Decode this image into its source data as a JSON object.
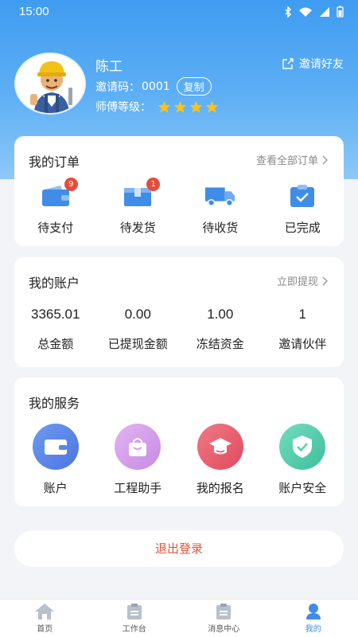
{
  "status_bar": {
    "time": "15:00"
  },
  "profile": {
    "name": "陈工",
    "invite_label": "邀请码：",
    "invite_code": "0001",
    "copy_label": "复制",
    "level_label": "师傅等级：",
    "stars": 4,
    "invite_friend_label": "邀请好友"
  },
  "orders": {
    "title": "我的订单",
    "link": "查看全部订单",
    "items": [
      {
        "label": "待支付",
        "badge": "9",
        "icon": "wallet-icon"
      },
      {
        "label": "待发货",
        "badge": "1",
        "icon": "package-icon"
      },
      {
        "label": "待收货",
        "badge": "",
        "icon": "truck-icon"
      },
      {
        "label": "已完成",
        "badge": "",
        "icon": "clipboard-check-icon"
      }
    ]
  },
  "account": {
    "title": "我的账户",
    "link": "立即提现",
    "items": [
      {
        "value": "3365.01",
        "label": "总金额"
      },
      {
        "value": "0.00",
        "label": "已提现金额"
      },
      {
        "value": "1.00",
        "label": "冻结资金"
      },
      {
        "value": "1",
        "label": "邀请伙伴"
      }
    ]
  },
  "services": {
    "title": "我的服务",
    "items": [
      {
        "label": "账户",
        "icon": "wallet-icon",
        "color": "#5b86e8"
      },
      {
        "label": "工程助手",
        "icon": "bag-icon",
        "color": "#d6a0ec"
      },
      {
        "label": "我的报名",
        "icon": "graduation-cap-icon",
        "color": "#e85a6e"
      },
      {
        "label": "账户安全",
        "icon": "shield-check-icon",
        "color": "#58cfb0"
      }
    ]
  },
  "logout_label": "退出登录",
  "tabbar": {
    "items": [
      {
        "label": "首页",
        "icon": "home-icon"
      },
      {
        "label": "工作台",
        "icon": "clipboard-icon"
      },
      {
        "label": "消息中心",
        "icon": "message-icon"
      },
      {
        "label": "我的",
        "icon": "user-icon",
        "active": true
      }
    ]
  },
  "colors": {
    "header_blue": "#3f9cf0",
    "accent_blue": "#3f8de8",
    "logout_red": "#e0533c",
    "star_yellow": "#f7c21c",
    "badge_red": "#e64c3c"
  }
}
